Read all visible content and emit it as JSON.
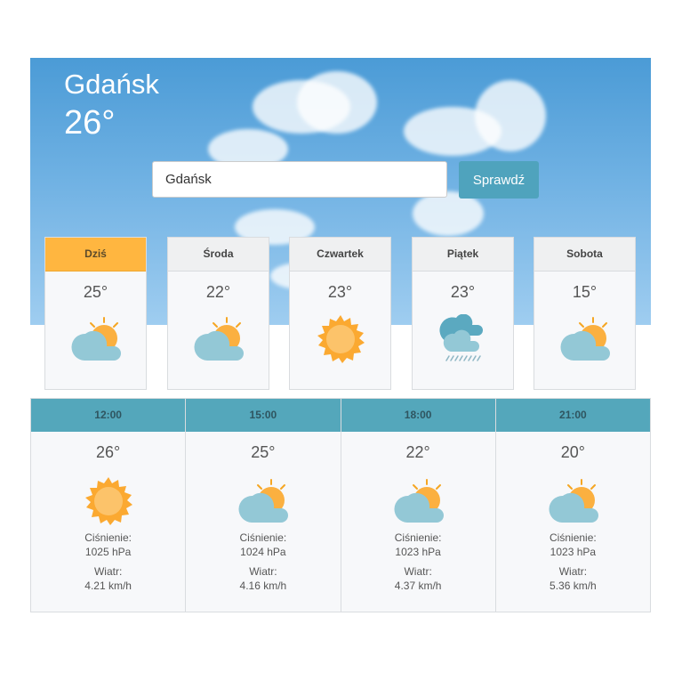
{
  "city": "Gdańsk",
  "current_temp": "26°",
  "search": {
    "value": "Gdańsk",
    "button_label": "Sprawdź"
  },
  "days": [
    {
      "label": "Dziś",
      "temp": "25°",
      "icon": "partly-cloudy-icon",
      "active": true
    },
    {
      "label": "Środa",
      "temp": "22°",
      "icon": "partly-cloudy-icon"
    },
    {
      "label": "Czwartek",
      "temp": "23°",
      "icon": "sun-icon"
    },
    {
      "label": "Piątek",
      "temp": "23°",
      "icon": "rain-clouds-icon"
    },
    {
      "label": "Sobota",
      "temp": "15°",
      "icon": "partly-cloudy-icon"
    }
  ],
  "hourly": [
    {
      "time": "12:00",
      "temp": "26°",
      "icon": "sun-icon",
      "pressure_label": "Ciśnienie:",
      "pressure": "1025 hPa",
      "wind_label": "Wiatr:",
      "wind": "4.21 km/h"
    },
    {
      "time": "15:00",
      "temp": "25°",
      "icon": "partly-cloudy-icon",
      "pressure_label": "Ciśnienie:",
      "pressure": "1024 hPa",
      "wind_label": "Wiatr:",
      "wind": "4.16 km/h"
    },
    {
      "time": "18:00",
      "temp": "22°",
      "icon": "partly-cloudy-icon",
      "pressure_label": "Ciśnienie:",
      "pressure": "1023 hPa",
      "wind_label": "Wiatr:",
      "wind": "4.37 km/h"
    },
    {
      "time": "21:00",
      "temp": "20°",
      "icon": "partly-cloudy-icon",
      "pressure_label": "Ciśnienie:",
      "pressure": "1023 hPa",
      "wind_label": "Wiatr:",
      "wind": "5.36 km/h"
    }
  ],
  "colors": {
    "accent": "#ffb640",
    "header": "#54a7bb",
    "button": "#4fa3bd"
  }
}
